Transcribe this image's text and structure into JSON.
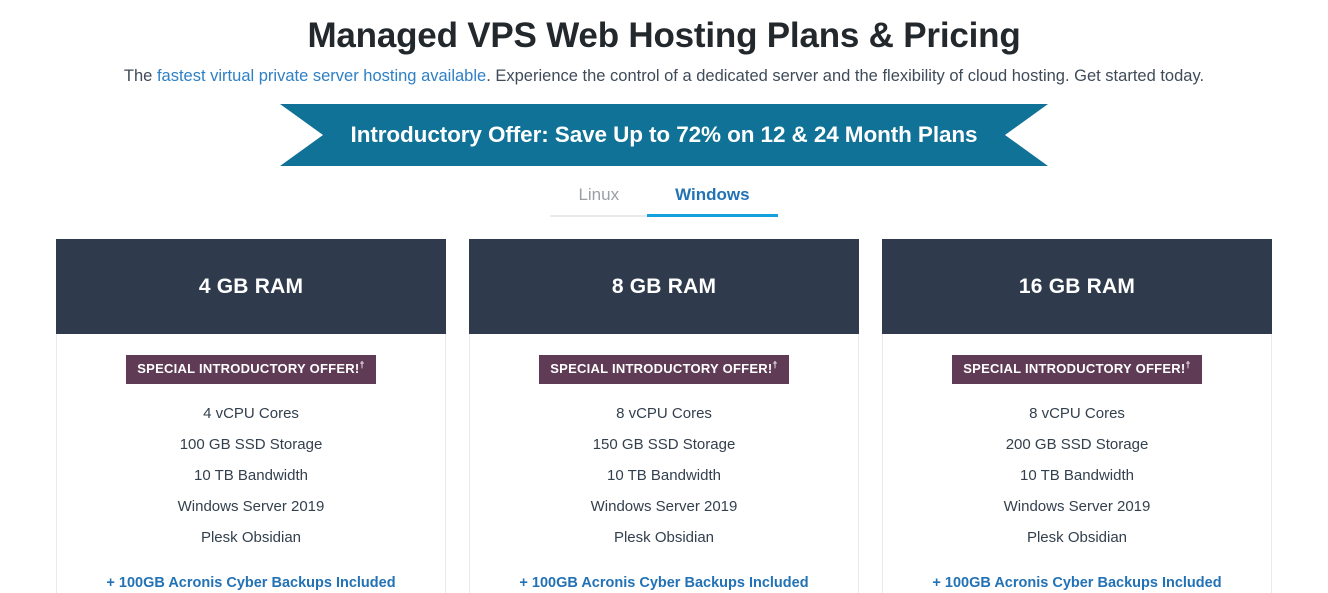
{
  "header": {
    "title": "Managed VPS Web Hosting Plans & Pricing",
    "subtitle_prefix": "The ",
    "subtitle_link": "fastest virtual private server hosting available",
    "subtitle_suffix": ". Experience the control of a dedicated server and the flexibility of cloud hosting. Get started today."
  },
  "ribbon": {
    "text": "Introductory Offer: Save Up to 72% on 12 & 24 Month Plans",
    "background_color": "#0f7296",
    "text_color": "#ffffff"
  },
  "tabs": {
    "items": [
      {
        "label": "Linux",
        "active": false
      },
      {
        "label": "Windows",
        "active": true
      }
    ],
    "active_color": "#2272b5",
    "active_underline_color": "#14a0dc",
    "inactive_color": "#9aa0a6"
  },
  "plans": [
    {
      "title": "4 GB RAM",
      "badge": "SPECIAL INTRODUCTORY OFFER!",
      "badge_superscript": "†",
      "features": [
        "4 vCPU Cores",
        "100 GB SSD Storage",
        "10 TB Bandwidth",
        "Windows Server 2019",
        "Plesk Obsidian"
      ],
      "backup": "+ 100GB Acronis Cyber Backups Included"
    },
    {
      "title": "8 GB RAM",
      "badge": "SPECIAL INTRODUCTORY OFFER!",
      "badge_superscript": "†",
      "features": [
        "8 vCPU Cores",
        "150 GB SSD Storage",
        "10 TB Bandwidth",
        "Windows Server 2019",
        "Plesk Obsidian"
      ],
      "backup": "+ 100GB Acronis Cyber Backups Included"
    },
    {
      "title": "16 GB RAM",
      "badge": "SPECIAL INTRODUCTORY OFFER!",
      "badge_superscript": "†",
      "features": [
        "8 vCPU Cores",
        "200 GB SSD Storage",
        "10 TB Bandwidth",
        "Windows Server 2019",
        "Plesk Obsidian"
      ],
      "backup": "+ 100GB Acronis Cyber Backups Included"
    }
  ],
  "colors": {
    "card_header_bg": "#2f3b4c",
    "badge_bg": "#5f3b55",
    "link_blue": "#2272b5"
  }
}
